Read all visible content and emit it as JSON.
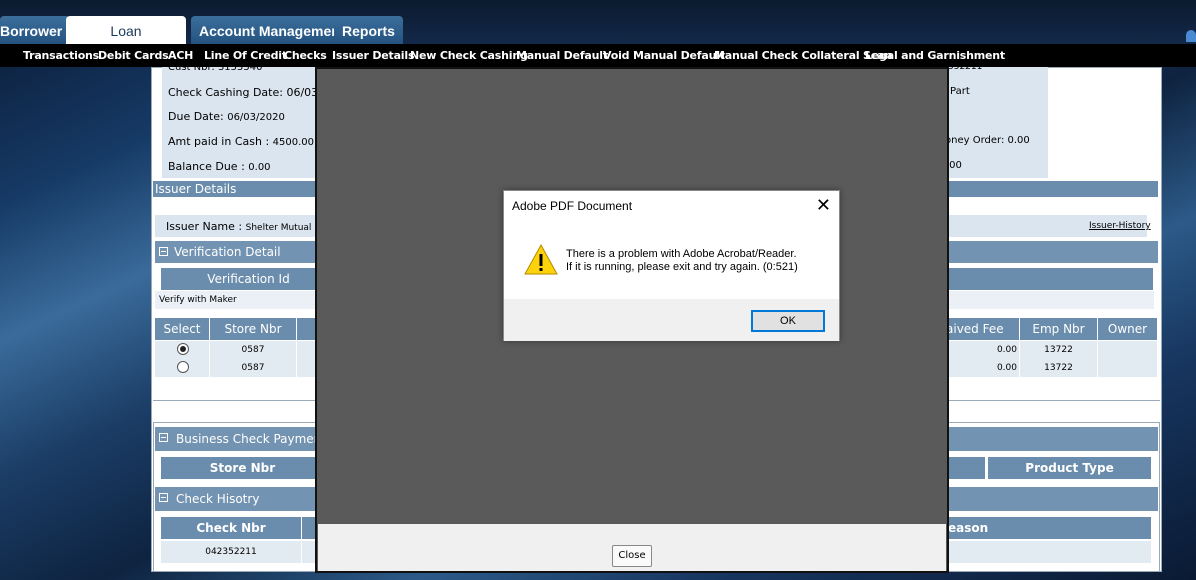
{
  "main_tabs": [
    "Borrower",
    "Loan Transactions",
    "Account Management",
    "Reports"
  ],
  "subnav": [
    "Transactions",
    "Debit Cards",
    "ACH",
    "Line Of Credit",
    "Checks",
    "Issuer Details",
    "New Check Cashing",
    "Manual Default",
    "Void Manual Default",
    "Manual Check Collateral Scan",
    "Legal and Garnishment"
  ],
  "info": {
    "cust_nbr": "Cust Nbr: 3155540",
    "check_cashing_date": "Check Cashing Date: 06/03/202",
    "due_date_label": "Due Date: ",
    "due_date": "06/03/2020",
    "amt_label": "Amt paid in Cash : ",
    "amt": "4500.00",
    "bal_label": "Balance Due : ",
    "bal": "0.00",
    "right_top": "552211",
    "right_part": "Part",
    "right_money": "oney Order: 0.00",
    "right_bal": ".00"
  },
  "issuer": {
    "header": "Issuer Details",
    "name_label": "Issuer Name : ",
    "name": "Shelter Mutual Ins",
    "history_link": "Issuer-History"
  },
  "verification": {
    "header": "Verification Detail",
    "col": "Verification Id",
    "row": "Verify with Maker"
  },
  "store_table": {
    "cols": [
      "Select",
      "Store Nbr",
      "aived Fee",
      "Emp Nbr",
      "Owner"
    ],
    "rows": [
      {
        "store": "0587",
        "fee": "0.00",
        "emp": "13722"
      },
      {
        "store": "0587",
        "fee": "0.00",
        "emp": "13722"
      }
    ]
  },
  "business": {
    "header": "Business Check Payments",
    "col_store": "Store Nbr",
    "col_product": "Product Type"
  },
  "history": {
    "header": "Check Hisotry",
    "col_check": "Check Nbr",
    "col_reason": "eason",
    "row_check": "042352211"
  },
  "viewer": {
    "close_label": "Close"
  },
  "dialog": {
    "title": "Adobe PDF Document",
    "close_glyph": "✕",
    "line1": "There is a problem with Adobe Acrobat/Reader.",
    "line2": "If it is running, please exit and try again. (0:521)",
    "ok_label": "OK"
  }
}
